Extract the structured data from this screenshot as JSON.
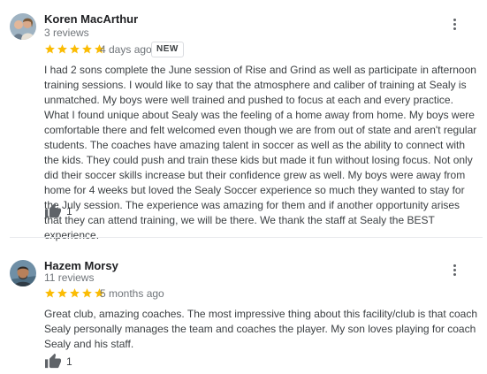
{
  "reviews": [
    {
      "author": "Koren MacArthur",
      "review_count": "3 reviews",
      "rating": 5,
      "time": "4 days ago",
      "badge": "NEW",
      "text": "I had 2 sons complete the June session of Rise and Grind as well as participate in afternoon training sessions. I would like to say that the atmosphere and caliber of training at Sealy is unmatched. My boys were well trained and pushed to focus at each and every practice. What I found unique about Sealy was the feeling of a home away from home. My boys were comfortable there and felt welcomed even though we are from out of state and aren't regular students. The coaches have amazing talent in soccer as well as the ability to connect with the kids. They could push and train these kids but made it fun without losing focus. Not only did their soccer skills increase but their confidence grew as well. My boys were away from home for 4 weeks but loved the Sealy Soccer experience so much they wanted to stay for the July session. The experience was amazing for them and if another opportunity arises that they can attend training, we will be there. We thank the staff at Sealy the BEST experience.",
      "likes": "1"
    },
    {
      "author": "Hazem Morsy",
      "review_count": "11 reviews",
      "rating": 5,
      "time": "5 months ago",
      "badge": "",
      "text": "Great club, amazing coaches. The most impressive thing about this facility/club is that coach Sealy personally manages the team and coaches the player. My son loves playing for coach Sealy and his staff.",
      "likes": "1"
    }
  ],
  "icons": {
    "star": "star-icon",
    "menu": "more-vert-icon",
    "like": "thumb-up-icon"
  },
  "colors": {
    "star": "#fbbc04",
    "muted": "#70757a",
    "icon": "#5f6368"
  }
}
